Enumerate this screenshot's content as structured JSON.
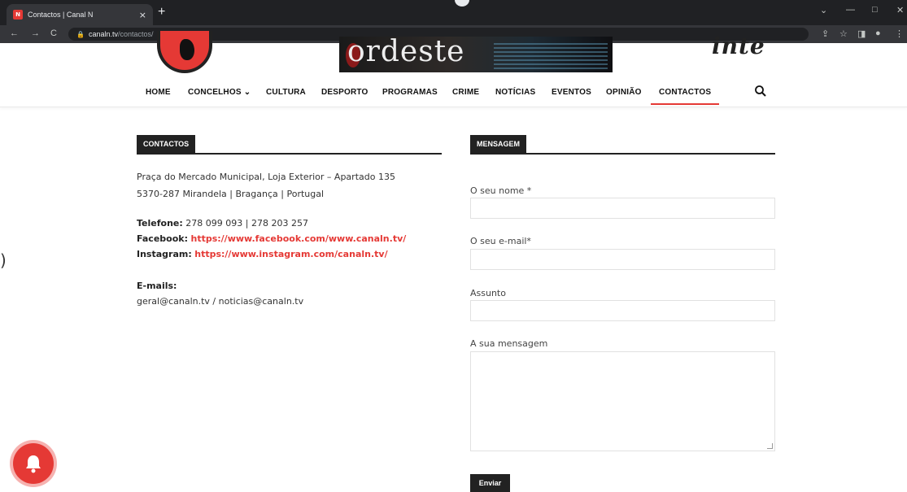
{
  "browser": {
    "tab_title": "Contactos | Canal N",
    "tab_close": "×",
    "new_tab": "+",
    "url_domain": "canaln.tv",
    "url_path": "/contactos/",
    "back": "←",
    "forward": "→",
    "reload": "C",
    "minimize": "—",
    "maximize": "□",
    "close": "✕",
    "chevron": "⌄"
  },
  "header": {
    "banner_text": "ordeste",
    "right_banner_text": "inte"
  },
  "nav": {
    "items": [
      {
        "label": "HOME"
      },
      {
        "label": "CONCELHOS"
      },
      {
        "label": "CULTURA"
      },
      {
        "label": "DESPORTO"
      },
      {
        "label": "PROGRAMAS"
      },
      {
        "label": "CRIME"
      },
      {
        "label": "NOTÍCIAS"
      },
      {
        "label": "EVENTOS"
      },
      {
        "label": "OPINIÃO"
      },
      {
        "label": "CONTACTOS"
      }
    ],
    "dropdown_chevron": "⌄",
    "active": "CONTACTOS"
  },
  "contacts": {
    "heading": "CONTACTOS",
    "address_line1": "Praça do Mercado Municipal, Loja Exterior – Apartado 135",
    "address_line2": "5370-287 Mirandela | Bragança | Portugal",
    "phone_label": "Telefone:",
    "phone_value": "278 099 093 | 278 203 257",
    "facebook_label": "Facebook:",
    "facebook_url": "https://www.facebook.com/www.canaln.tv/",
    "instagram_label": "Instagram:",
    "instagram_url": "https://www.instagram.com/canaln.tv/",
    "emails_label": "E-mails:",
    "emails_value": "geral@canaln.tv / noticias@canaln.tv"
  },
  "message": {
    "heading": "MENSAGEM",
    "name_label": "O seu nome *",
    "email_label": "O seu e-mail*",
    "subject_label": "Assunto",
    "message_label": "A sua mensagem",
    "submit_label": "Enviar"
  },
  "colors": {
    "accent": "#e53935",
    "dark": "#222222"
  }
}
